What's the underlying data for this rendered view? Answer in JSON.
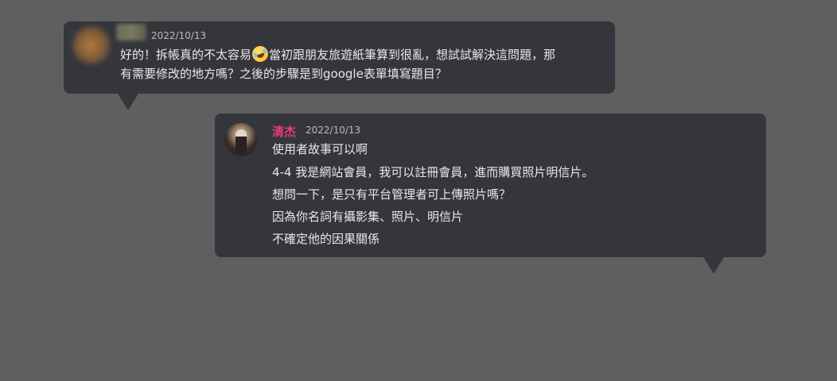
{
  "messages": [
    {
      "username_visible": false,
      "timestamp": "2022/10/13",
      "lines": [
        {
          "before_emoji": "好的！拆帳真的不太容易",
          "emoji": "rofl-emoji",
          "after_emoji": "當初跟朋友旅遊紙筆算到很亂，想試試解決這問題，那"
        },
        {
          "text": "有需要修改的地方嗎？之後的步驟是到google表單填寫題目？"
        }
      ]
    },
    {
      "username": "清杰",
      "username_color": "#ee3a7a",
      "timestamp": "2022/10/13",
      "lines": [
        "使用者故事可以啊",
        "4-4 我是網站會員，我可以註冊會員，進而購買照片明信片。",
        "想問一下，是只有平台管理者可上傳照片嗎？",
        "因為你名詞有攝影集、照片、明信片",
        "不確定他的因果關係"
      ]
    }
  ],
  "colors": {
    "background": "#5f5f5f",
    "bubble": "#35363b",
    "text": "#e8e8ea",
    "timestamp": "#b9bbbe"
  }
}
